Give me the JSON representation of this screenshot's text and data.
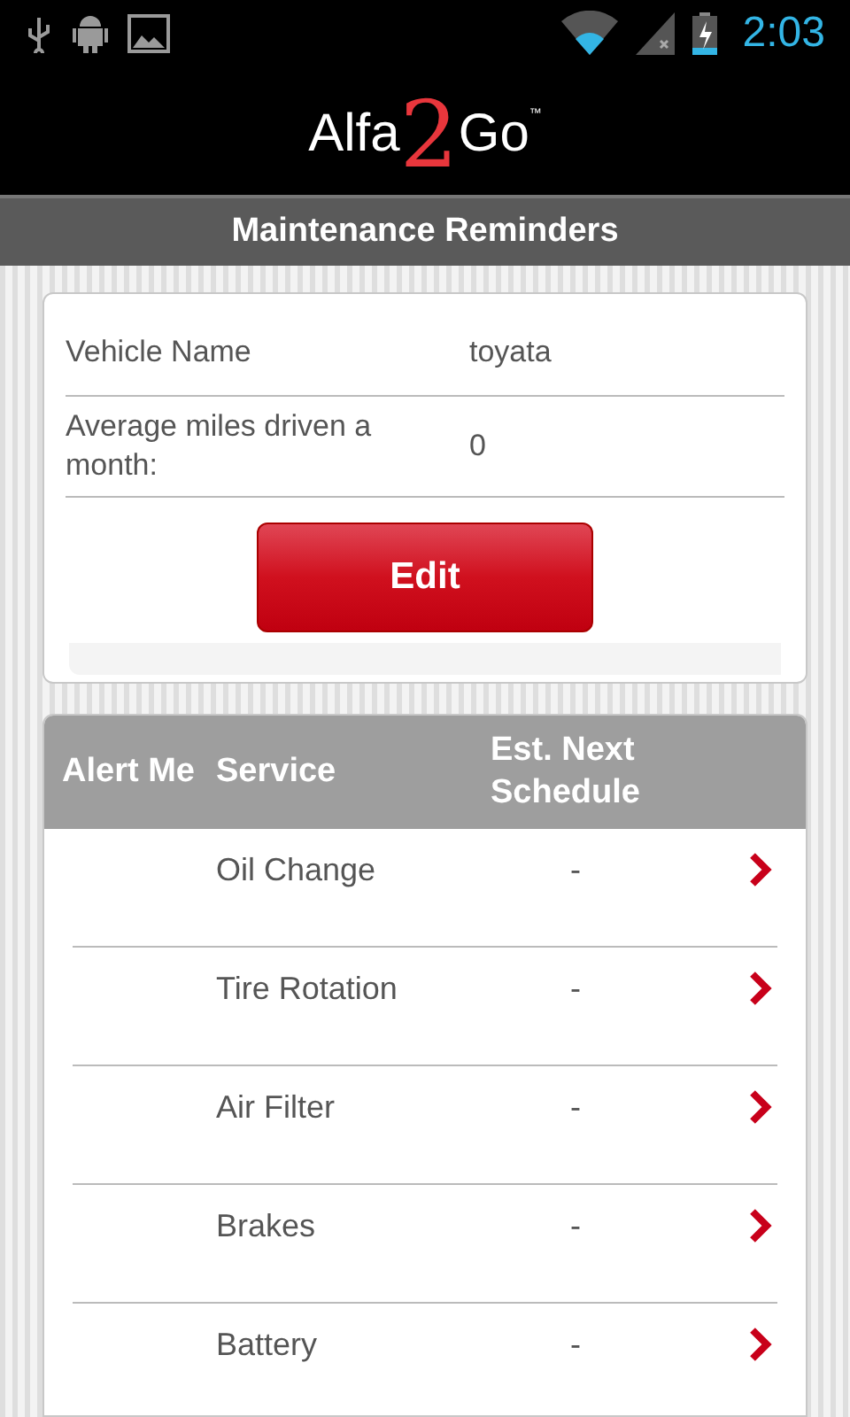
{
  "status_bar": {
    "time": "2:03"
  },
  "header": {
    "logo": {
      "part_1": "Alfa",
      "part_2": "2",
      "part_3": "Go",
      "mark": "™"
    }
  },
  "title": "Maintenance Reminders",
  "vehicle": {
    "fields": [
      {
        "label": "Vehicle Name",
        "value": "toyata"
      },
      {
        "label": "Average miles driven a month:",
        "value": "0"
      }
    ],
    "edit_button": "Edit"
  },
  "table": {
    "columns": [
      "Alert Me",
      "Service",
      "Est. Next Schedule"
    ],
    "rows": [
      {
        "service": "Oil Change",
        "next": "-"
      },
      {
        "service": "Tire Rotation",
        "next": "-"
      },
      {
        "service": "Air Filter",
        "next": "-"
      },
      {
        "service": "Brakes",
        "next": "-"
      },
      {
        "service": "Battery",
        "next": "-"
      }
    ]
  }
}
